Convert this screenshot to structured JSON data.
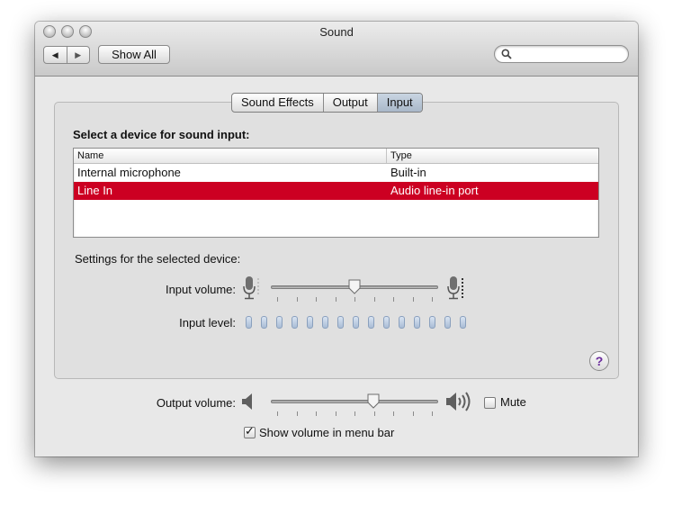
{
  "window": {
    "title": "Sound"
  },
  "toolbar": {
    "back_glyph": "◀",
    "forward_glyph": "▶",
    "show_all_label": "Show All",
    "search_placeholder": ""
  },
  "tabs": [
    {
      "label": "Sound Effects",
      "active": false
    },
    {
      "label": "Output",
      "active": false
    },
    {
      "label": "Input",
      "active": true
    }
  ],
  "input": {
    "section_label": "Select a device for sound input:",
    "columns": {
      "name": "Name",
      "type": "Type"
    },
    "devices": [
      {
        "name": "Internal microphone",
        "type": "Built-in",
        "selected": false
      },
      {
        "name": "Line In",
        "type": "Audio line-in port",
        "selected": true
      }
    ],
    "settings_label": "Settings for the selected device:",
    "volume_label": "Input volume:",
    "volume_fraction": 0.5,
    "level_label": "Input level:",
    "level_cells": 15,
    "level_filled": 0
  },
  "help": {
    "glyph": "?"
  },
  "output": {
    "volume_label": "Output volume:",
    "volume_fraction": 0.62,
    "mute_label": "Mute",
    "mute_checked": false,
    "menu_bar_label": "Show volume in menu bar",
    "menu_bar_checked": true
  },
  "colors": {
    "selection": "#cc0022",
    "tab_active": "#b5c3d3"
  }
}
